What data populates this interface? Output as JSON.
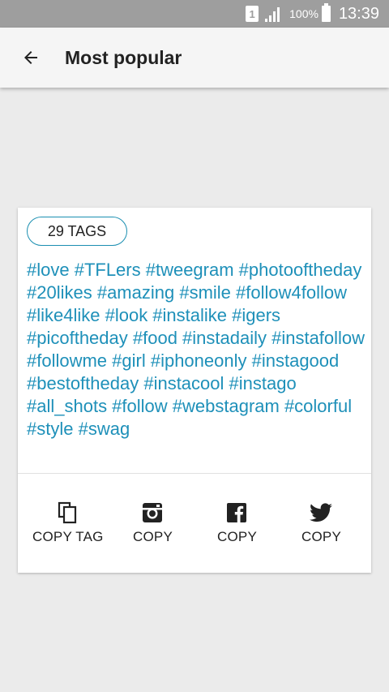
{
  "status_bar": {
    "sim_label": "1",
    "battery_percent": "100%",
    "time": "13:39"
  },
  "app_bar": {
    "title": "Most popular",
    "back_icon": "arrow-back-icon"
  },
  "card": {
    "tag_count_label": "29 TAGS",
    "tags_text": "#love #TFLers #tweegram #photooftheday #20likes #amazing #smile #follow4follow #like4like #look #instalike #igers #picoftheday #food #instadaily #instafollow #followme #girl #iphoneonly #instagood #bestoftheday #instacool #instago #all_shots #follow #webstagram #colorful #style #swag",
    "actions": [
      {
        "icon": "copy-icon",
        "label": "COPY TAG"
      },
      {
        "icon": "instagram-icon",
        "label": "COPY"
      },
      {
        "icon": "facebook-icon",
        "label": "COPY"
      },
      {
        "icon": "twitter-icon",
        "label": "COPY"
      }
    ]
  },
  "colors": {
    "accent": "#1e90b9",
    "status_bar": "#9e9e9e",
    "background": "#ebebeb"
  }
}
